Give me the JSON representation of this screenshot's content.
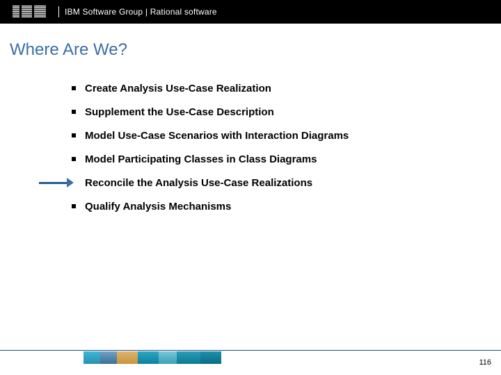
{
  "header": {
    "brand": "IBM",
    "text": "IBM Software Group | Rational software"
  },
  "title": "Where Are We?",
  "bullets": [
    {
      "text": "Create Analysis Use-Case Realization",
      "highlighted": false
    },
    {
      "text": "Supplement the Use-Case Description",
      "highlighted": false
    },
    {
      "text": "Model Use-Case Scenarios with Interaction Diagrams",
      "highlighted": false
    },
    {
      "text": "Model Participating Classes in Class Diagrams",
      "highlighted": false
    },
    {
      "text": "Reconcile the Analysis Use-Case Realizations",
      "highlighted": true
    },
    {
      "text": "Qualify Analysis Mechanisms",
      "highlighted": false
    }
  ],
  "page_number": "116"
}
